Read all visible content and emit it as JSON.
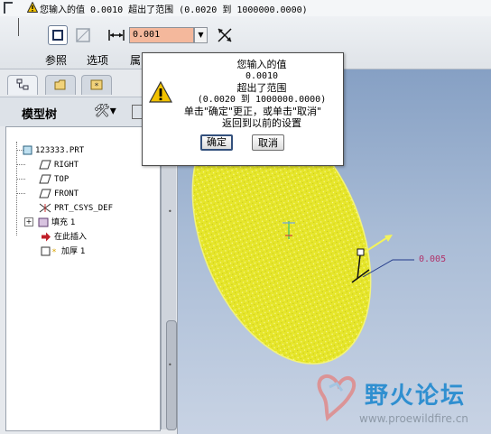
{
  "message_bar": {
    "text": "您输入的值 0.0010 超出了范围 (0.0020 到 1000000.0000)"
  },
  "dashboard": {
    "value": "0.001",
    "tabs": [
      "参照",
      "选项",
      "属"
    ]
  },
  "nav_tabs": [
    "model-tree-tab",
    "folder-tab",
    "favorites-tab"
  ],
  "model_tree": {
    "title": "模型树",
    "items": [
      {
        "label": "123333.PRT",
        "icon": "part-icon"
      },
      {
        "label": "RIGHT",
        "icon": "datum-plane-icon"
      },
      {
        "label": "TOP",
        "icon": "datum-plane-icon"
      },
      {
        "label": "FRONT",
        "icon": "datum-plane-icon"
      },
      {
        "label": "PRT_CSYS_DEF",
        "icon": "csys-icon"
      },
      {
        "label": "填充 1",
        "icon": "fill-feature-icon"
      },
      {
        "label": "在此插入",
        "icon": "insert-arrow-icon"
      },
      {
        "label": "加厚 1",
        "icon": "thicken-feature-icon"
      }
    ]
  },
  "viewport": {
    "dimension": "0.005"
  },
  "dialog": {
    "lines": [
      "您输入的值",
      "0.0010",
      "超出了范围",
      "(0.0020 到 1000000.0000)",
      "单击\"确定\"更正，或单击\"取消\"",
      "返回到以前的设置"
    ],
    "ok": "确定",
    "cancel": "取消"
  },
  "watermark": {
    "name": "野火论坛",
    "url": "www.proewildfire.cn"
  },
  "colors": {
    "surface": "#e6e62a",
    "input_error": "#f4b89c",
    "warning": "#f2c200",
    "dimension": "#b0326a"
  }
}
